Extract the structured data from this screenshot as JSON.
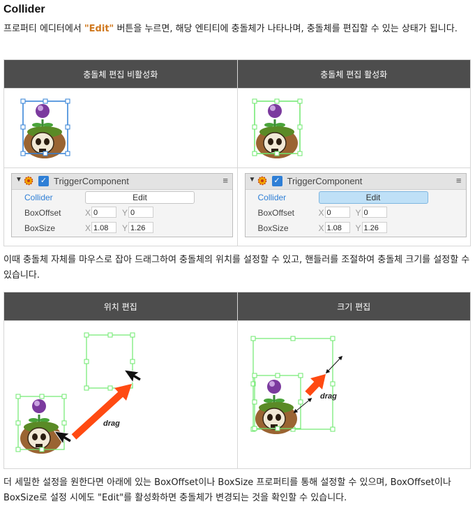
{
  "title": "Collider",
  "intro": {
    "before": "프로퍼티 에디터에서 ",
    "highlight": "\"Edit\"",
    "after": " 버튼을 누르면, 해당 엔티티에 충돌체가 나타나며, 충돌체를 편집할 수 있는 상태가 됩니다."
  },
  "table1": {
    "headers": [
      "충돌체 편집 비활성화",
      "충돌체 편집 활성화"
    ]
  },
  "inspector": {
    "component_name": "TriggerComponent",
    "rows": {
      "collider_label": "Collider",
      "edit_label": "Edit",
      "boxoffset_label": "BoxOffset",
      "boxsize_label": "BoxSize"
    },
    "axis_x": "X",
    "axis_y": "Y",
    "boxoffset": {
      "x": "0",
      "y": "0"
    },
    "boxsize": {
      "x": "1.08",
      "y": "1.26"
    }
  },
  "middle_para": "이때 충돌체 자체를 마우스로 잡아 드래그하여 충돌체의 위치를 설정할 수 있고, 핸들러를 조절하여 충돌체 크기를 설정할 수 있습니다.",
  "table2": {
    "headers": [
      "위치 편집",
      "크기 편집"
    ],
    "drag_label": "drag"
  },
  "footer_para": "더 세밀한 설정을 원한다면 아래에 있는 BoxOffset이나 BoxSize 프로퍼티를 통해 설정할 수 있으며, BoxOffset이나 BoxSize로 설정 시에도 \"Edit\"를 활성화하면 충돌체가 변경되는 것을 확인할 수 있습니다.",
  "colors": {
    "header_bg": "#4d4d4d",
    "highlight": "#d0781e",
    "collider_green": "#6ee86e",
    "collider_blue": "#2f7fd6",
    "arrow_orange": "#ff4a12"
  }
}
